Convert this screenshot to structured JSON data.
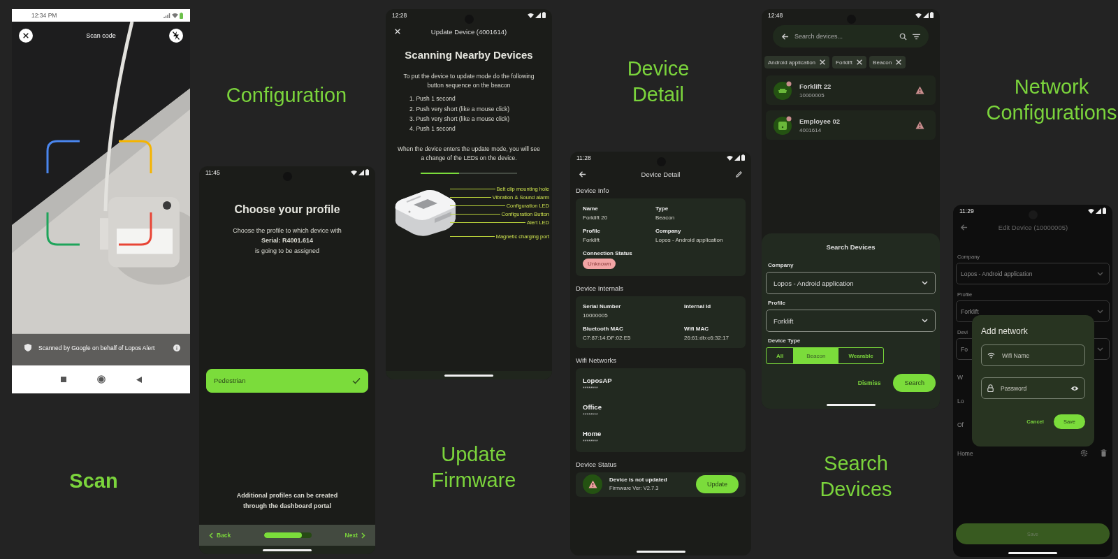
{
  "screens": [
    {
      "kind": "scan",
      "caption": "Scan",
      "status_time": "12:34 PM",
      "title": "Scan code",
      "footer": "Scanned by Google on behalf of Lopos Alert"
    },
    {
      "kind": "profile",
      "caption": "Configuration",
      "status_time": "11:45",
      "title": "Choose your profile",
      "intro": [
        "Choose the profile to which device with",
        "**Serial: R4001.614**",
        "is going to be assigned"
      ],
      "profiles": [
        {
          "label": "Pedestrian",
          "selected": true
        }
      ],
      "note": "Additional profiles can be created through the dashboard portal",
      "back": "Back",
      "next": "Next",
      "progress": {
        "level": 0.8
      }
    },
    {
      "kind": "firmware",
      "caption": "Update Firmware",
      "status_time": "12:28",
      "title": "Update Device (4001614)",
      "heading": "Scanning Nearby Devices",
      "intro": "To put the device to update mode do the following button sequence on the beacon",
      "steps": [
        "1. Push 1 second",
        "2. Push very short (like a mouse click)",
        "3. Push very short (like a mouse click)",
        "4. Push 1 second"
      ],
      "outro": "When the device enters the update mode, you will see a change of the LEDs on the device.",
      "progress": {
        "level": 0.4
      },
      "diagram_labels": [
        "Belt clip mounting hole",
        "Vibration & Sound alarm",
        "Configuration LED",
        "Configuration Button",
        "Alert LED",
        "Magnetic charging port"
      ]
    },
    {
      "kind": "detail",
      "caption": "Device Detail",
      "status_time": "11:28",
      "title": "Device Detail",
      "info": {
        "title": "Device Info",
        "fields": [
          {
            "label": "Name",
            "value": "Forklift 20"
          },
          {
            "label": "Type",
            "value": "Beacon"
          },
          {
            "label": "Profile",
            "value": "Forklift"
          },
          {
            "label": "Company",
            "value": "Lopos - Android application"
          }
        ],
        "status_label": "Connection Status",
        "status": "Unknown"
      },
      "internals": {
        "title": "Device Internals",
        "fields": [
          {
            "label": "Serial Number",
            "value": "10000005"
          },
          {
            "label": "Internal Id"
          },
          {
            "label": "Bluetooth MAC",
            "value": "C7:87:14:DF:02:E5"
          },
          {
            "label": "Wifi MAC",
            "value": "26:61:db:c6:32:17"
          }
        ]
      },
      "wifi": {
        "title": "Wifi Networks",
        "networks": [
          {
            "name": "LoposAP",
            "password": "********"
          },
          {
            "name": "Office",
            "password": "********"
          },
          {
            "name": "Home",
            "password": "********"
          }
        ]
      },
      "device_status": {
        "title": "Device Status",
        "message": "Device is not updated",
        "firmware": "Firmware Ver: V2.7.3",
        "action": "Update"
      }
    },
    {
      "kind": "search",
      "caption": "Search Devices",
      "status_time": "12:48",
      "search": {
        "placeholder": "Search devices..."
      },
      "chips": [
        "Android application",
        "Forklift",
        "Beacon"
      ],
      "devices": [
        {
          "kind": "forklift",
          "name": "Forklift 22",
          "serial": "10000005"
        },
        {
          "kind": "wearable",
          "name": "Employee 02",
          "serial": "4001614"
        }
      ],
      "sheet": {
        "title": "Search Devices",
        "fields": [
          {
            "label": "Company",
            "value": "Lopos - Android application"
          },
          {
            "label": "Profile",
            "value": "Forklift"
          }
        ],
        "type_label": "Device Type",
        "types": [
          {
            "label": "All",
            "selected": false
          },
          {
            "label": "Beacon",
            "selected": true
          },
          {
            "label": "Wearable",
            "selected": false
          }
        ],
        "dismiss": "Dismiss",
        "submit": "Search"
      }
    },
    {
      "kind": "network",
      "caption": "Network Configurations",
      "status_time": "11:29",
      "title": "Edit Device (10000005)",
      "fields": [
        {
          "label": "Company",
          "value": "Lopos - Android application"
        },
        {
          "label": "Profile",
          "value": "Forklift"
        },
        {
          "label": "Devi",
          "value": "Fo"
        }
      ],
      "rows": [
        "W",
        "Lo",
        "Of"
      ],
      "network": {
        "name": "Home"
      },
      "save": "Save",
      "dialog": {
        "title": "Add network",
        "fields": [
          {
            "kind": "wifi",
            "placeholder": "Wifi Name"
          },
          {
            "kind": "password",
            "placeholder": "Password"
          }
        ],
        "cancel": "Cancel",
        "confirm": "Save"
      }
    }
  ]
}
